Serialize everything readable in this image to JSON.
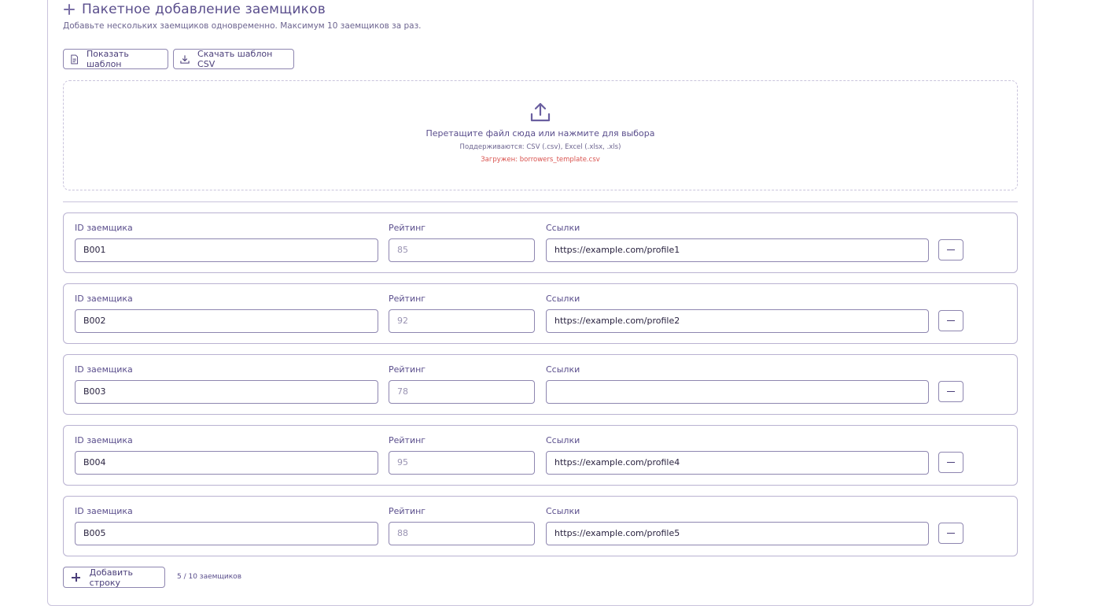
{
  "section": {
    "title": "Пакетное добавление заемщиков",
    "subtitle": "Добавьте нескольких заемщиков одновременно. Максимум 10 заемщиков за раз."
  },
  "toolbar": {
    "show_template_label": "Показать шаблон",
    "download_csv_label": "Скачать шаблон CSV"
  },
  "dropzone": {
    "main_text": "Перетащите файл сюда или нажмите для выбора",
    "supported_text": "Поддерживаются: CSV (.csv), Excel (.xlsx, .xls)",
    "loaded_text": "Загружен: borrowers_template.csv"
  },
  "columns": {
    "id_label": "ID заемщика",
    "rating_label": "Рейтинг",
    "links_label": "Ссылки"
  },
  "rows": [
    {
      "id": "B001",
      "rating": "85",
      "links": "https://example.com/profile1"
    },
    {
      "id": "B002",
      "rating": "92",
      "links": "https://example.com/profile2"
    },
    {
      "id": "B003",
      "rating": "78",
      "links": ""
    },
    {
      "id": "B004",
      "rating": "95",
      "links": "https://example.com/profile4"
    },
    {
      "id": "B005",
      "rating": "88",
      "links": "https://example.com/profile5"
    }
  ],
  "footer": {
    "add_row_label": "Добавить строку",
    "counter": "5 / 10 заемщиков"
  },
  "icons": {
    "header": "plus-icon",
    "template": "document-icon",
    "download": "download-icon",
    "upload": "upload-icon",
    "remove": "minus-icon"
  }
}
